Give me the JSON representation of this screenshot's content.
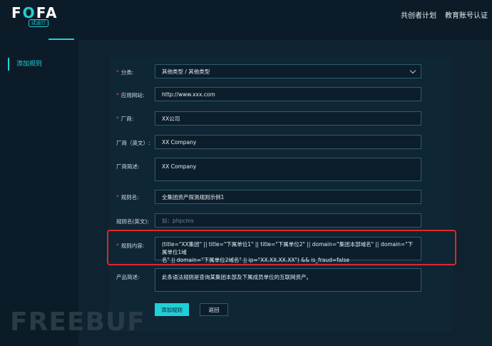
{
  "header": {
    "logo_text_a": "F",
    "logo_text_b": "O",
    "logo_text_c": "FA",
    "logo_badge": "试运行",
    "nav": [
      "共创者计划",
      "教育账号认证"
    ]
  },
  "sidebar": {
    "items": [
      {
        "label": "添加规则"
      }
    ]
  },
  "form": {
    "category": {
      "label": "分类:",
      "required": true,
      "value": "其他类型 / 其他类型"
    },
    "website": {
      "label": "应用网站:",
      "required": true,
      "value": "http://www.xxx.com"
    },
    "vendor": {
      "label": "厂商:",
      "required": true,
      "value": "XX公司"
    },
    "vendor_en": {
      "label": "厂商（英文）:",
      "required": false,
      "value": "XX Company"
    },
    "vendor_desc": {
      "label": "厂商简述:",
      "required": false,
      "value": "XX Company"
    },
    "rule_name": {
      "label": "规则名:",
      "required": true,
      "value": "全集团资产探测规则示例1"
    },
    "rule_name_en": {
      "label": "规则名(英文):",
      "required": false,
      "value": "",
      "placeholder": "如：phpcms"
    },
    "rule_content": {
      "label": "规则内容:",
      "required": true,
      "line1": "(title=\"XX集团\" || title=\"下属单位1\" || title=\"下属单位2\" || domain=\"集团本部域名\" || domain=\"下属单位1域",
      "line2": "名\" || domain=\"下属单位2域名\" || ip=\"XX.XX.XX.XX\")  && is_fraud=false"
    },
    "product_desc": {
      "label": "产品简述:",
      "required": false,
      "value": "此条语法规则是查询某集团本部及下属成员单位的互联网资产。"
    }
  },
  "buttons": {
    "add": "添加规则",
    "back": "返回"
  },
  "watermark": "FREEBUF",
  "colors": {
    "accent": "#1fd0d8",
    "background": "#0b1b27",
    "required": "#e24a4a",
    "highlight": "#e0282a"
  }
}
